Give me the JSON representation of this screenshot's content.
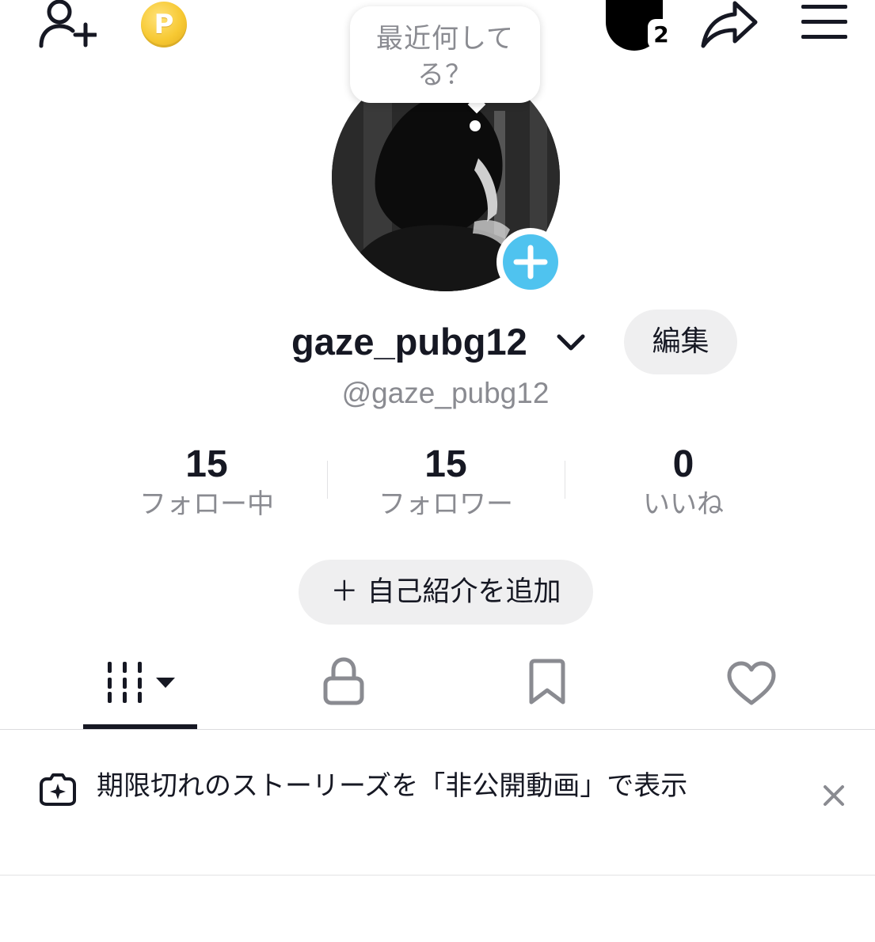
{
  "header": {
    "add_friend_icon": "person-plus-icon",
    "coin_icon": "coin-icon",
    "coin_letter": "P",
    "profile_badge_count": "2",
    "share_icon": "share-arrow-icon",
    "menu_icon": "hamburger-icon"
  },
  "status_bubble": {
    "text": "最近何してる？"
  },
  "profile": {
    "display_name": "gaze_pubg12",
    "username": "@gaze_pubg12",
    "edit_label": "編集",
    "add_photo_color": "#4fc3ef"
  },
  "stats": [
    {
      "value": "15",
      "label": "フォロー中"
    },
    {
      "value": "15",
      "label": "フォロワー"
    },
    {
      "value": "0",
      "label": "いいね"
    }
  ],
  "bio": {
    "add_label": "＋ 自己紹介を追加"
  },
  "tabs": [
    {
      "icon": "videos-grid-icon",
      "active": true
    },
    {
      "icon": "lock-icon",
      "active": false
    },
    {
      "icon": "bookmark-icon",
      "active": false
    },
    {
      "icon": "heart-icon",
      "active": false
    }
  ],
  "notice": {
    "icon": "story-sparkle-icon",
    "text": "期限切れのストーリーズを「非公開動画」で表示",
    "close_icon": "close-icon"
  }
}
